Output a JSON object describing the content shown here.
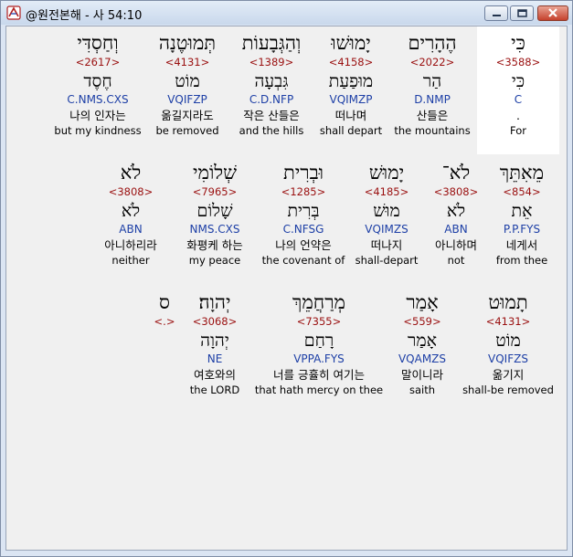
{
  "window": {
    "title": "@원전본해 - 사 54:10",
    "icons": {
      "app": "bible-app-icon",
      "minimize": "minimize-icon",
      "maximize": "maximize-icon",
      "close": "close-icon"
    }
  },
  "rows": [
    {
      "words": [
        {
          "heb": "כִּי",
          "num": "<3588>",
          "lex": "כִּי",
          "parse": "C",
          "kor": ".",
          "eng": "For"
        },
        {
          "heb": "הֶהָרִים",
          "num": "<2022>",
          "lex": "הַר",
          "parse": "D.NMP",
          "kor": "산들은",
          "eng": "the mountains"
        },
        {
          "heb": "יָמוּשׁוּ",
          "num": "<4158>",
          "lex": "מוּפַעַת",
          "parse": "VQIMZP",
          "kor": "떠나며",
          "eng": "shall depart"
        },
        {
          "heb": "וְהַגְּבָעוֹת",
          "num": "<1389>",
          "lex": "גִּבְעָה",
          "parse": "C.D.NFP",
          "kor": "작은 산들은",
          "eng": "and the hills"
        },
        {
          "heb": "תְּמוּטֶנָה",
          "num": "<4131>",
          "lex": "מוֹט",
          "parse": "VQIFZP",
          "kor": "옮길지라도",
          "eng": "be removed"
        },
        {
          "heb": "וְחַסְדִּי",
          "num": "<2617>",
          "lex": "חֶסֶד",
          "parse": "C.NMS.CXS",
          "kor": "나의 인자는",
          "eng": "but my kindness"
        }
      ]
    },
    {
      "words": [
        {
          "heb": "מֵאִתֵּךְ",
          "num": "<854>",
          "lex": "אֵת",
          "parse": "P.P.FYS",
          "kor": "네게서",
          "eng": "from thee"
        },
        {
          "heb": "לֹא־",
          "num": "<3808>",
          "lex": "לֹא",
          "parse": "ABN",
          "kor": "아니하며",
          "eng": "not"
        },
        {
          "heb": "יָמוּשׁ",
          "num": "<4185>",
          "lex": "מוּשׁ",
          "parse": "VQIMZS",
          "kor": "떠나지",
          "eng": "shall-depart"
        },
        {
          "heb": "וּבְרִית",
          "num": "<1285>",
          "lex": "בְּרִית",
          "parse": "C.NFSG",
          "kor": "나의 언약은",
          "eng": "the covenant of"
        },
        {
          "heb": "שְׁלוֹמִי",
          "num": "<7965>",
          "lex": "שָׁלוֹם",
          "parse": "NMS.CXS",
          "kor": "화평케 하는",
          "eng": "my peace"
        },
        {
          "heb": "לֹא",
          "num": "<3808>",
          "lex": "לֹא",
          "parse": "ABN",
          "kor": "아니하리라",
          "eng": "neither"
        }
      ]
    },
    {
      "words": [
        {
          "heb": "תָמוּט",
          "num": "<4131>",
          "lex": "מוֹט",
          "parse": "VQIFZS",
          "kor": "옮기지",
          "eng": "shall-be removed"
        },
        {
          "heb": "אָמַר",
          "num": "<559>",
          "lex": "אָמַר",
          "parse": "VQAMZS",
          "kor": "말이니라",
          "eng": "saith"
        },
        {
          "heb": "מְרַחֲמֵךְ",
          "num": "<7355>",
          "lex": "רָחַם",
          "parse": "VPPA.FYS",
          "kor": "너를 긍휼히 여기는",
          "eng": "that hath mercy on thee"
        },
        {
          "heb": "יְהוָה׃",
          "num": "<3068>",
          "lex": "יְהוָה",
          "parse": "NE",
          "kor": "여호와의",
          "eng": "the LORD"
        },
        {
          "heb": "ס",
          "num": "<.>",
          "lex": "",
          "parse": "",
          "kor": "",
          "eng": ""
        }
      ]
    }
  ]
}
